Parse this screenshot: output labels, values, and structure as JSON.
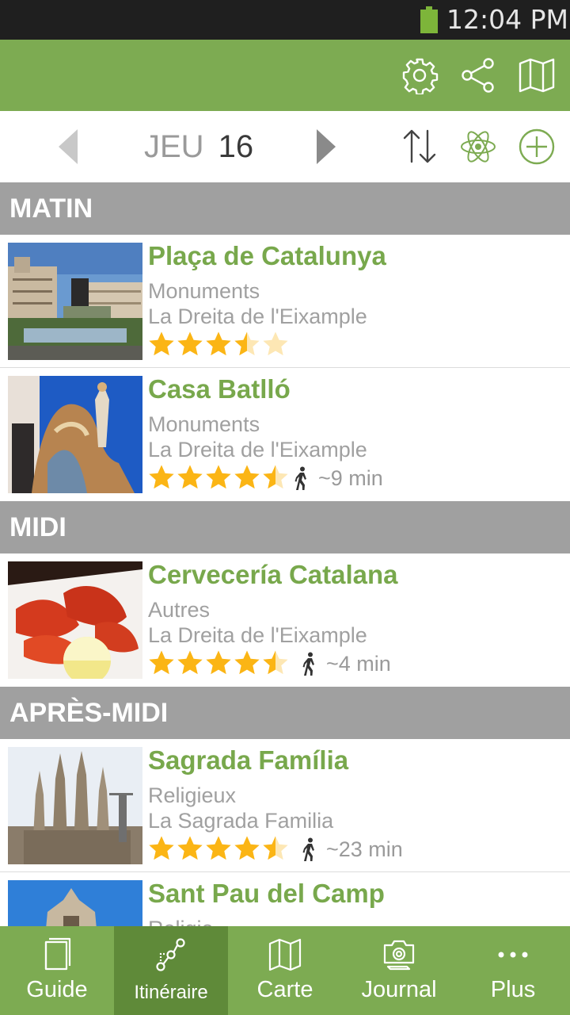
{
  "status_bar": {
    "time": "12:04 PM"
  },
  "toolbar": {
    "icons": [
      "gear-icon",
      "share-icon",
      "map-icon"
    ]
  },
  "date_nav": {
    "day": "JEU",
    "date": "16",
    "icons": [
      "chevron-left-icon",
      "chevron-right-icon",
      "sort-icon",
      "atom-icon",
      "add-circle-icon"
    ]
  },
  "sections": [
    {
      "label": "MATIN",
      "items": [
        {
          "title": "Plaça de Catalunya",
          "category": "Monuments",
          "district": "La Dreita de l'Eixample",
          "rating": 3.5,
          "walk": ""
        },
        {
          "title": "Casa Batlló",
          "category": "Monuments",
          "district": "La Dreita de l'Eixample",
          "rating": 4.5,
          "walk": "~9 min"
        }
      ]
    },
    {
      "label": "MIDI",
      "items": [
        {
          "title": "Cervecería Catalana",
          "category": "Autres",
          "district": "La Dreita de l'Eixample",
          "rating": 4.5,
          "walk": "~4 min"
        }
      ]
    },
    {
      "label": "APRÈS-MIDI",
      "items": [
        {
          "title": "Sagrada Família",
          "category": "Religieux",
          "district": "La Sagrada Familia",
          "rating": 4.5,
          "walk": "~23 min"
        },
        {
          "title": "Sant Pau del Camp",
          "category": "Religie",
          "district": "",
          "rating": 0,
          "walk": ""
        }
      ]
    }
  ],
  "bottom_nav": [
    {
      "label": "Guide",
      "icon": "book-icon",
      "active": false
    },
    {
      "label": "Itinéraire",
      "icon": "route-icon",
      "active": true
    },
    {
      "label": "Carte",
      "icon": "map-icon",
      "active": false
    },
    {
      "label": "Journal",
      "icon": "camera-icon",
      "active": false
    },
    {
      "label": "Plus",
      "icon": "more-icon",
      "active": false
    }
  ],
  "colors": {
    "accent": "#7dab52",
    "accent_dark": "#5f8a39",
    "title_green": "#78a84c",
    "section_gray": "#a0a0a0",
    "star": "#fbb515"
  }
}
